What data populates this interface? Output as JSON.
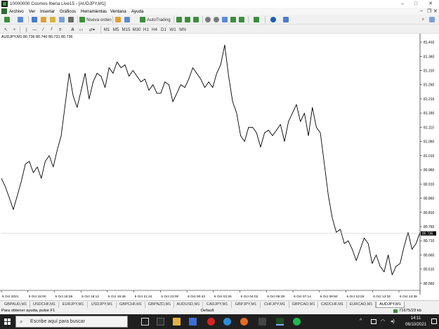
{
  "window": {
    "title": "10000000 Cosmos Iberia Live15 - [AUDJPY,M1]"
  },
  "menu": {
    "items": [
      "Archivo",
      "Ver",
      "Insertar",
      "Gráficos",
      "Herramientas",
      "Ventana",
      "Ayuda"
    ]
  },
  "toolbar": {
    "new_order": "Nueva orden",
    "autotrading": "AutoTrading",
    "timeframes": [
      "M1",
      "M5",
      "M15",
      "M30",
      "H1",
      "H4",
      "D1",
      "W1",
      "MN"
    ],
    "text_tool": "A"
  },
  "chart": {
    "header": "AUDJPY,M1  80.736 80.740 80.731 80.736",
    "current_price": "80.736",
    "accent_colors": {
      "line": "#000000",
      "price_tag": "#000000",
      "grid": "#c0c0c0"
    }
  },
  "chart_data": {
    "type": "line",
    "title": "AUDJPY,M1",
    "yticks": [
      "81.410",
      "81.360",
      "81.310",
      "81.260",
      "81.210",
      "81.160",
      "81.110",
      "81.060",
      "81.010",
      "80.960",
      "80.910",
      "80.860",
      "80.810",
      "80.760",
      "80.710",
      "80.660",
      "80.610",
      "80.560"
    ],
    "xticks": [
      "5 Oct 2021",
      "5 Oct 15:00",
      "5 Oct 16:36",
      "5 Oct 18:12",
      "5 Oct 19:48",
      "5 Oct 21:24",
      "5 Oct 23:00",
      "6 Oct 00:43",
      "6 Oct 02:26",
      "6 Oct 04:02",
      "6 Oct 05:38",
      "6 Oct 07:14",
      "6 Oct 08:50",
      "6 Oct 10:26",
      "6 Oct 12:02",
      "6 Oct 13:38"
    ],
    "ylim": [
      80.54,
      81.42
    ],
    "series": [
      {
        "values": [
          80.93,
          80.9,
          80.86,
          80.82,
          80.87,
          80.92,
          80.98,
          80.99,
          80.95,
          80.97,
          80.93,
          80.99,
          81.01,
          80.97,
          81.03,
          81.08,
          81.19,
          81.3,
          81.22,
          81.18,
          81.24,
          81.3,
          81.21,
          81.27,
          81.3,
          81.29,
          81.25,
          81.32,
          81.3,
          81.34,
          81.32,
          81.33,
          81.29,
          81.31,
          81.29,
          81.27,
          81.28,
          81.24,
          81.26,
          81.23,
          81.23,
          81.27,
          81.26,
          81.2,
          81.23,
          81.26,
          81.25,
          81.28,
          81.32,
          81.3,
          81.28,
          81.25,
          81.27,
          81.25,
          81.3,
          81.33,
          81.4,
          81.29,
          81.2,
          81.16,
          81.08,
          81.06,
          81.11,
          81.11,
          81.09,
          81.04,
          81.09,
          81.1,
          81.08,
          81.1,
          81.12,
          81.06,
          81.13,
          81.16,
          81.19,
          81.13,
          81.16,
          81.08,
          81.18,
          81.11,
          81.09,
          80.98,
          80.87,
          80.79,
          80.74,
          80.75,
          80.7,
          80.71,
          80.68,
          80.64,
          80.68,
          80.72,
          80.7,
          80.63,
          80.66,
          80.62,
          80.6,
          80.66,
          80.59,
          80.62,
          80.63,
          80.69,
          80.74,
          80.68,
          80.7,
          80.74
        ]
      }
    ]
  },
  "tabs": {
    "items": [
      "GBPAUD,M1",
      "USDCHF,M1",
      "EURJPY,M1",
      "USDJPY,M1",
      "GBPCHF,M1",
      "GBPNZD,M1",
      "AUDUSD,M1",
      "CADJPY,M1",
      "GBPJPY,M1",
      "CHFJPY,M1",
      "GBPCAD,M1",
      "CADCHF,M1",
      "EURCAD,M1",
      "AUDJPY,M1"
    ],
    "active_index": 13
  },
  "status": {
    "help": "Para obtener ayuda, pulse F1",
    "profile": "Default",
    "traffic": "71675/23 kb"
  },
  "taskbar": {
    "search_placeholder": "Escribe aquí para buscar",
    "time": "14:11",
    "date": "06/10/2021"
  }
}
